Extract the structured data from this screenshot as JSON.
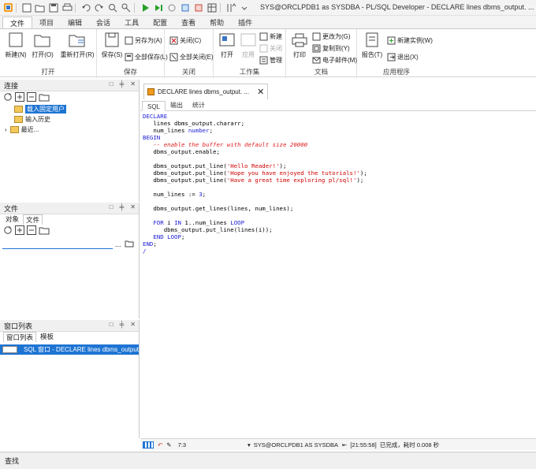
{
  "window": {
    "title": "SYS@ORCLPDB1 as SYSDBA - PL/SQL Developer - DECLARE lines dbms_output. ..."
  },
  "ribbon_tabs": [
    "文件",
    "项目",
    "编辑",
    "会话",
    "工具",
    "配置",
    "查看",
    "帮助",
    "插件"
  ],
  "ribbon": {
    "open_group": {
      "label": "打开",
      "new": "新建(N)",
      "open": "打开(O)",
      "reopen": "重新打开(R)"
    },
    "save_group": {
      "label": "保存",
      "save": "保存(S)",
      "save_as": "另存为(A)",
      "save_all": "全部保存(L)"
    },
    "close_group": {
      "label": "关闭",
      "close": "关闭(C)",
      "close_all": "全部关闭(E)"
    },
    "workset_group": {
      "label": "工作集",
      "open": "打开",
      "apply": "应用",
      "new": "新建",
      "close": "关闭",
      "manage": "管理"
    },
    "doc_group": {
      "label": "文档",
      "print": "打印",
      "change_to": "更改为(G)",
      "copy_to": "复制到(Y)",
      "email": "电子邮件(M)"
    },
    "app_group": {
      "label": "应用程序",
      "report": "报告(T)",
      "new_instance": "新建实例(W)",
      "exit": "退出(X)"
    }
  },
  "connections_panel": {
    "title": "连接",
    "items": [
      "载入固定用户",
      "输入历史",
      "最近..."
    ]
  },
  "files_panel": {
    "title": "文件",
    "tabs": [
      "对象",
      "文件"
    ],
    "browse": "..."
  },
  "window_list_panel": {
    "title": "窗口列表",
    "tabs": [
      "窗口列表",
      "模板"
    ],
    "item": "SQL 窗口 - DECLARE lines dbms_output"
  },
  "editor": {
    "doc_tab": "DECLARE lines dbms_output. ...",
    "tabs": [
      "SQL",
      "输出",
      "统计"
    ],
    "code": {
      "l1": "DECLARE",
      "l2": "   lines dbms_output.chararr;",
      "l3a": "   num_lines ",
      "l3b": "number",
      "l3c": ";",
      "l4": "BEGIN",
      "l5": "   -- enable the buffer with default size 20000",
      "l6": "   dbms_output.enable;",
      "l7a": "   dbms_output.put_line(",
      "l7b": "'Hello Reader!'",
      "l7c": ");",
      "l8b": "'Hope you have enjoyed the tutorials!'",
      "l9b": "'Have a great time exploring pl/sql!'",
      "l10a": "   num_lines := ",
      "l10b": "3",
      "l10c": ";",
      "l11": "   dbms_output.get_lines(lines, num_lines);",
      "l12a": "   FOR",
      "l12b": " i ",
      "l12c": "IN",
      "l12d": " 1..num_lines ",
      "l12e": "LOOP",
      "l13": "      dbms_output.put_line(lines(i));",
      "l14a": "   END LOOP",
      "l14b": ";",
      "l15a": "END",
      "l15b": ";",
      "l16": "/"
    }
  },
  "statusbar": {
    "position": "7:3",
    "connection": "SYS@ORCLPDB1 AS SYSDBA",
    "time": "[21:55:58]",
    "message": "已完成，耗时 0.008 秒"
  },
  "find_panel": {
    "title": "查找"
  }
}
